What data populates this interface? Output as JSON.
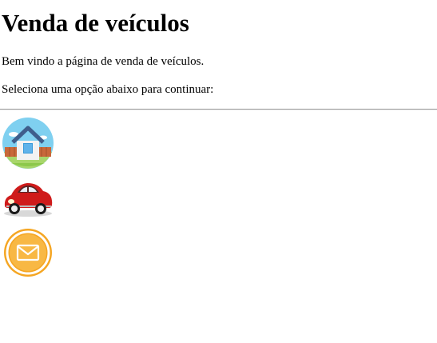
{
  "page": {
    "title": "Venda de veículos",
    "welcome": "Bem vindo a página de venda de veículos.",
    "instruction": "Seleciona uma opção abaixo para continuar:"
  },
  "options": [
    {
      "icon": "home-icon",
      "color": "#7ccff2"
    },
    {
      "icon": "car-icon",
      "color": "#cc1111"
    },
    {
      "icon": "mail-icon",
      "color": "#f5a623"
    }
  ]
}
